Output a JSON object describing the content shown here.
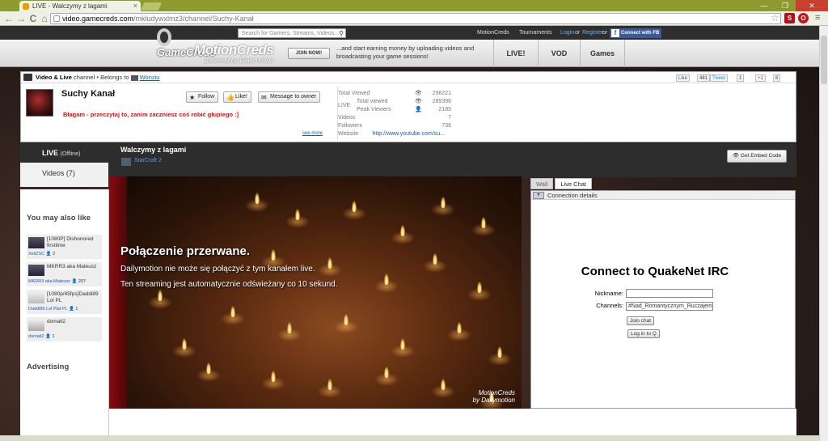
{
  "browser": {
    "tab_title": "LIVE - Walczymy z lagami",
    "tab_close": "×",
    "url_host": "video.gamecreds.com",
    "url_path": "/mkludywxlmz3/channel/Suchy-Kanał",
    "back": "←",
    "forward": "→",
    "reload": "C",
    "home": "⌂",
    "star": "☆",
    "wrench": "≡",
    "win_min": "—",
    "win_max": "❐",
    "win_close": "✕"
  },
  "header": {
    "logo_gamecreds": "GameCreds",
    "logo_motioncreds": "MotionCreds",
    "logo_powered": "powered by Dailymotion",
    "search_placeholder": "Search for Gamers, Streams, Videos...",
    "motioncreds_link": "MotionCreds",
    "tournaments_link": "Tournaments",
    "login_link": "Login",
    "or1": "or",
    "register_link": "Register",
    "or2": "or",
    "fb_connect": "Connect with FB",
    "join_now": "JOIN NOW!",
    "promo_text": "...and start earning money by uploading videos and broadcasting your game sessions!",
    "nav": [
      "LIVE!",
      "VOD",
      "Games"
    ]
  },
  "channel": {
    "type_label": "Video & Live",
    "channel_word": "channel",
    "belongs_to": "• Belongs to",
    "owner": "Wonziu",
    "name": "Suchy Kanał",
    "follow": "Follow",
    "like": "Like!",
    "message": "Message to owner",
    "description": "Błagam - przeczytaj to, zanim zaczniesz coś robić głupiego :]",
    "see_more": "see more",
    "share": {
      "fb_like": "Like",
      "fb_count": "481",
      "tweet": "Tweet",
      "tweet_count": "1",
      "gplus": "+1",
      "gplus_count": "8"
    }
  },
  "stats": {
    "total_viewed_label": "Total Viewed",
    "total_viewed": "298221",
    "live_label": "LIVE",
    "live_total_label": "Total viewed",
    "live_total": "289396",
    "peak_label": "Peak Viewers",
    "peak": "2185",
    "videos_label": "Videos",
    "videos": "7",
    "followers_label": "Followers",
    "followers": "736",
    "website_label": "Website",
    "website": "http://www.youtube.com/su..."
  },
  "player_strip": {
    "live_tab": "LIVE",
    "live_status": "(Offline)",
    "videos_tab": "Videos (7)",
    "stream_title": "Walczymy z lagami",
    "game": "StarCraft 2",
    "embed": "Get Embed Code"
  },
  "sidebar": {
    "also_like": "You may also like",
    "advertising": "Advertising",
    "items": [
      {
        "title": "[1080P] Dishonored firsttime",
        "user": "XeliZSC",
        "viewers": "2"
      },
      {
        "title": "MKRR3 aka Mateusz",
        "user": "MKRR3 aka Mateusz",
        "viewers": "207"
      },
      {
        "title": "[1080p/45fps]Daddi89 Lol PL",
        "user": "Daddi89 Lol Plat PL",
        "viewers": "1"
      },
      {
        "title": "domati2",
        "user": "domati2",
        "viewers": "1"
      }
    ]
  },
  "player": {
    "title": "Połączenie przerwane.",
    "line1": "Dailymotion nie może się połączyć z tym kanałem live.",
    "line2": "Ten streaming jest automatycznie odświeżany co 10 sekund.",
    "logo1": "MotionCreds",
    "logo2": "by Dailymotion"
  },
  "chat": {
    "tab_wall": "Wall",
    "tab_live_chat": "Live Chat",
    "connection_details": "Connection details",
    "irc_title": "Connect to QuakeNet IRC",
    "nickname_label": "Nickname:",
    "nickname_value": "",
    "channels_label": "Channels:",
    "channels_value": "#Nad_Romantycznym_Ruczajem",
    "join_chat": "Join chat",
    "login_q": "Log in to Q"
  }
}
